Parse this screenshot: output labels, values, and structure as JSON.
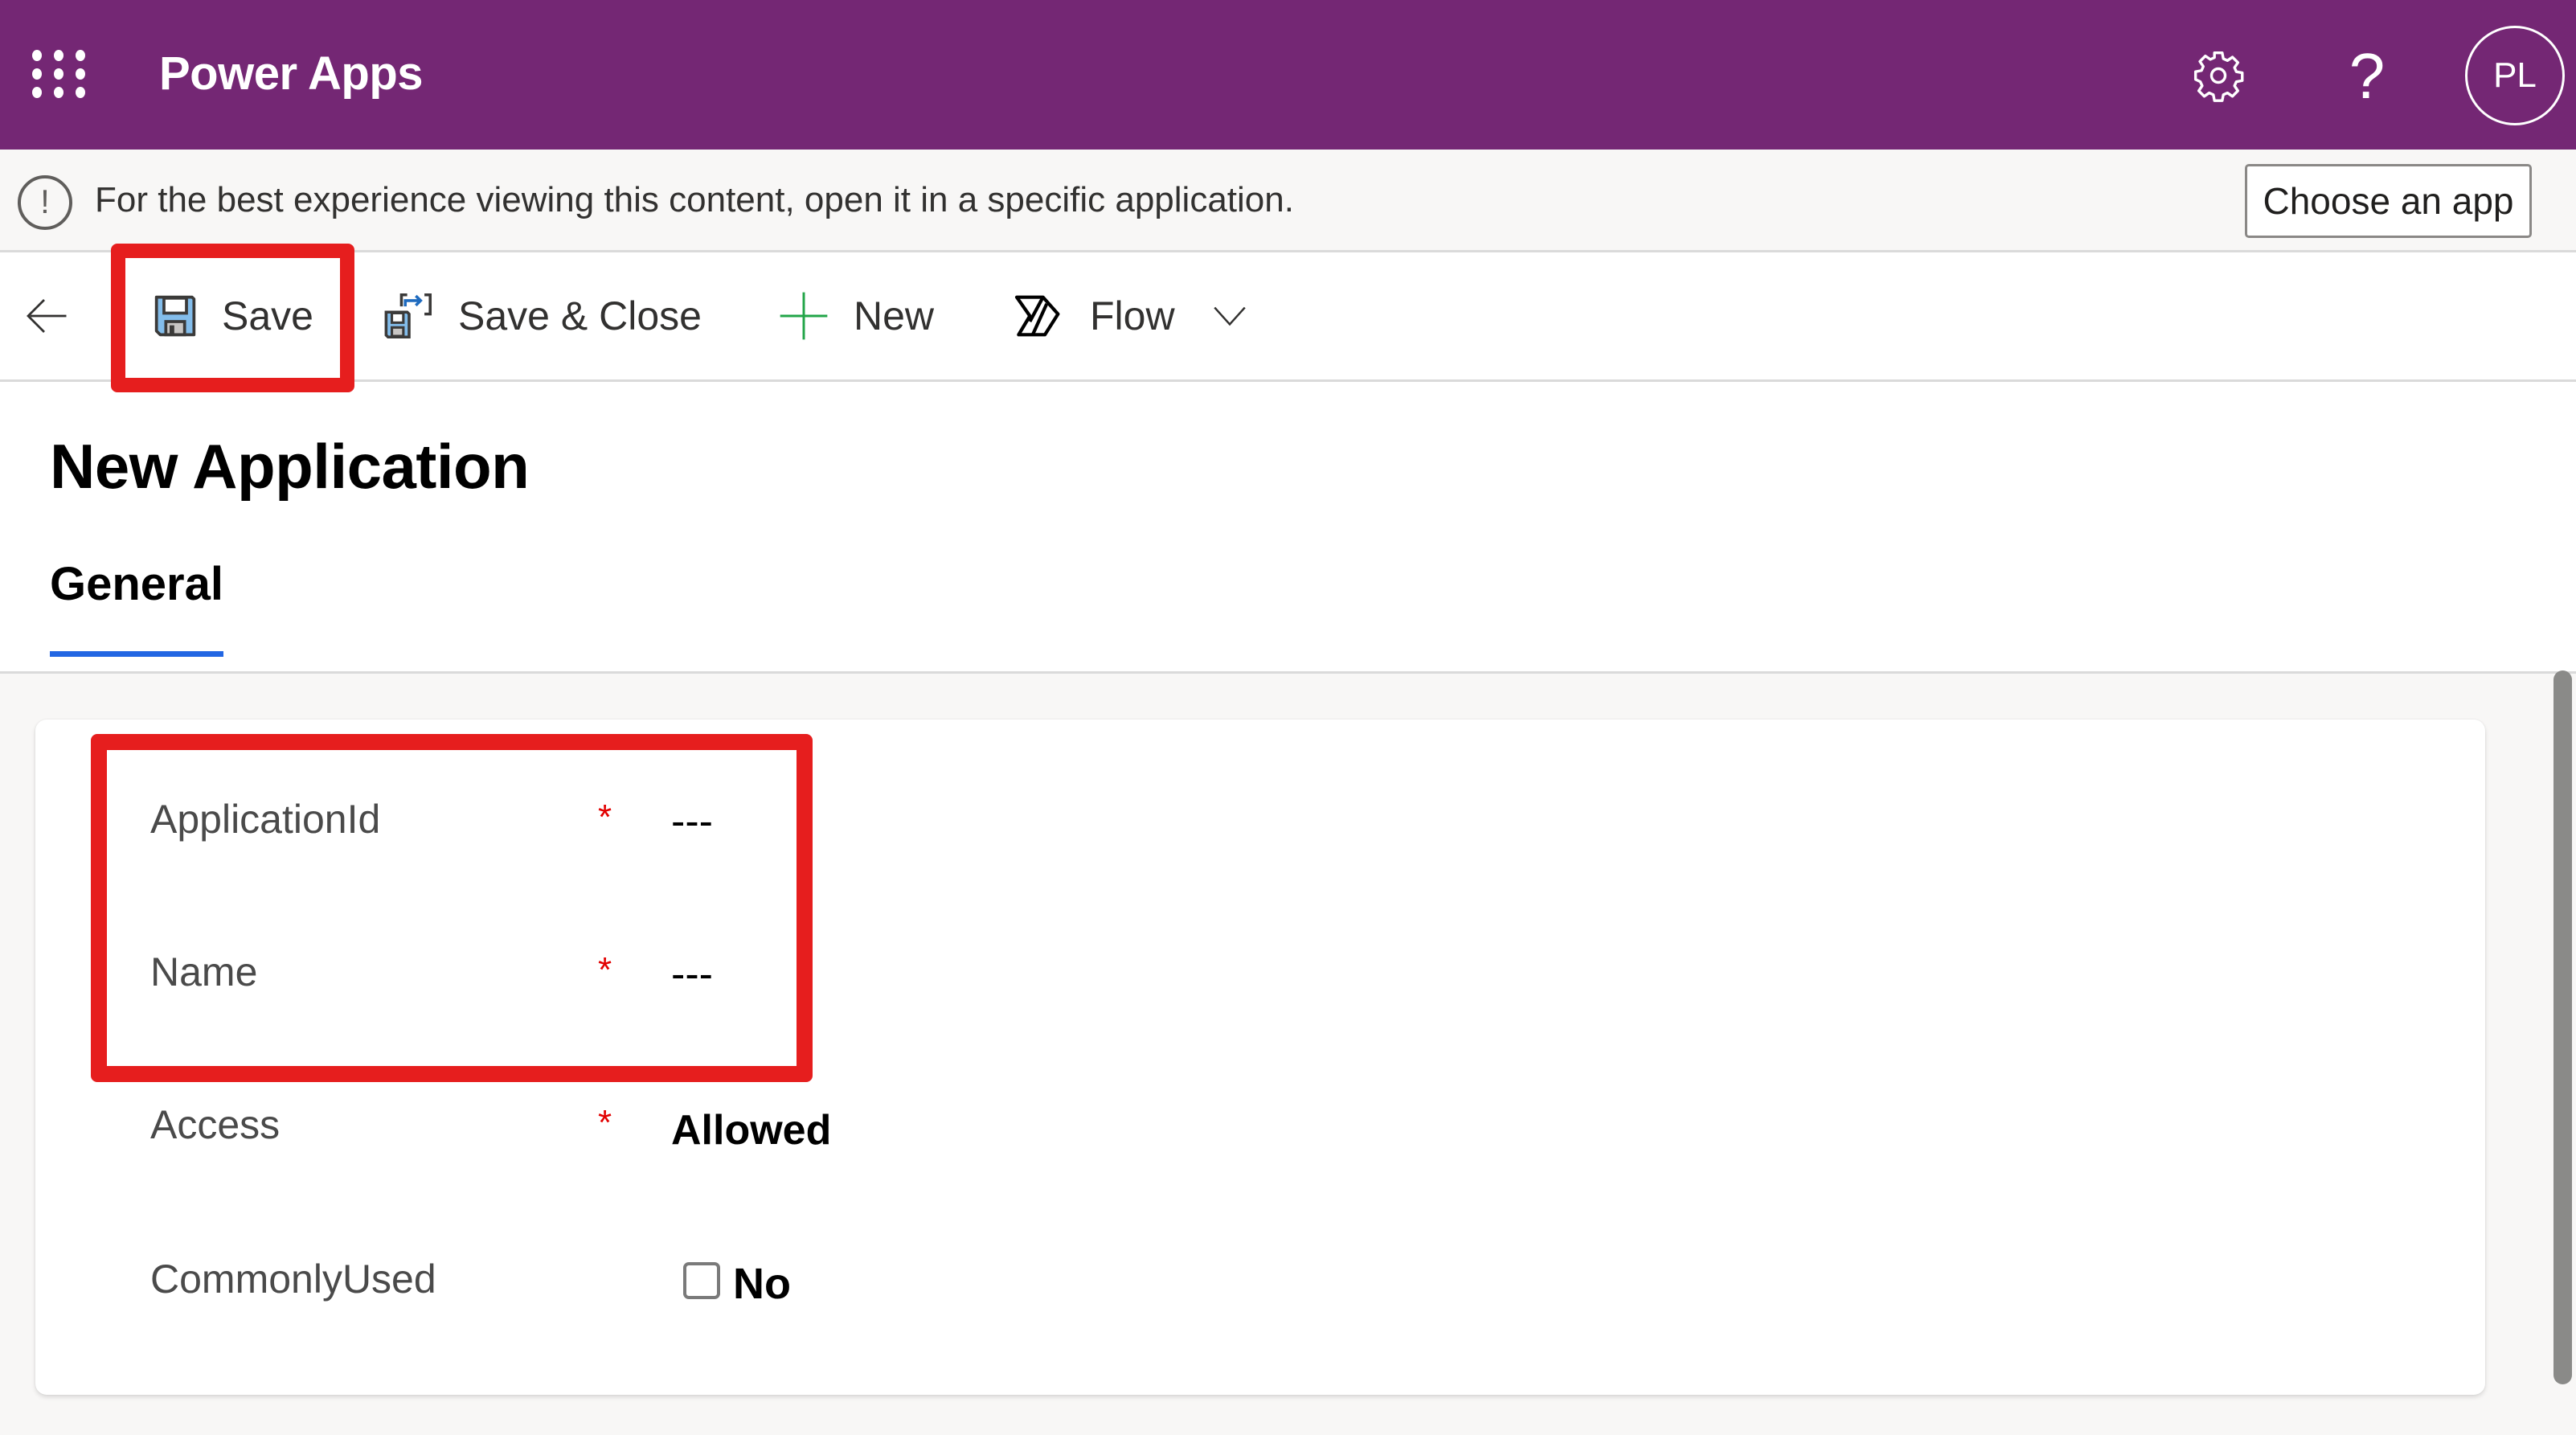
{
  "topbar": {
    "app_title": "Power Apps",
    "avatar_initials": "PL",
    "help_glyph": "?",
    "icons": [
      "waffle-icon",
      "gear-icon",
      "help-icon"
    ],
    "bg_color": "#742774"
  },
  "banner": {
    "message": "For the best experience viewing this content, open it in a specific application.",
    "button_label": "Choose an app",
    "icon": "info-icon",
    "icon_glyph": "!"
  },
  "toolbar": {
    "back_icon": "back-arrow-icon",
    "items": [
      {
        "label": "Save",
        "icon": "save-icon"
      },
      {
        "label": "Save & Close",
        "icon": "save-close-icon"
      },
      {
        "label": "New",
        "icon": "plus-icon"
      },
      {
        "label": "Flow",
        "icon": "flow-icon"
      }
    ],
    "overflow_icon": "chevron-down-icon"
  },
  "page": {
    "title": "New Application",
    "tabs": [
      {
        "label": "General",
        "active": true
      }
    ],
    "accent_color": "#2266e3"
  },
  "form": {
    "fields": [
      {
        "label": "ApplicationId",
        "required": true,
        "required_mark": "*",
        "value": "---"
      },
      {
        "label": "Name",
        "required": true,
        "required_mark": "*",
        "value": "---"
      },
      {
        "label": "Access",
        "required": true,
        "required_mark": "*",
        "value": "Allowed"
      },
      {
        "label": "CommonlyUsed",
        "required": false,
        "checked": false,
        "value": "No"
      }
    ]
  },
  "annotations": {
    "highlight_color": "#e61e1e"
  }
}
